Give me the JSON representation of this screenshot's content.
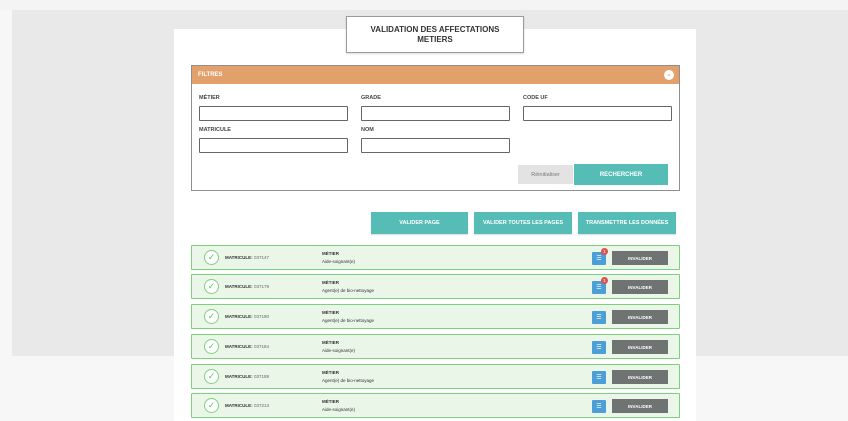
{
  "title": {
    "line1": "VALIDATION DES AFFECTATIONS",
    "line2": "METIERS"
  },
  "filters": {
    "header": "FILTRES",
    "metier_label": "MÉTIER",
    "grade_label": "GRADE",
    "code_uf_label": "CODE UF",
    "matricule_label": "MATRICULE",
    "nom_label": "NOM",
    "metier_value": "",
    "grade_value": "",
    "code_uf_value": "",
    "matricule_value": "",
    "nom_value": "",
    "reset_label": "Réinitialiser",
    "search_label": "RECHERCHER"
  },
  "toolbar": {
    "valider_page": "VALIDER PAGE",
    "valider_toutes": "VALIDER TOUTES LES PAGES",
    "transmettre": "TRANSMETTRE LES DONNÉES"
  },
  "rows": [
    {
      "matricule_label": "MATRICULE:",
      "matricule": "037147",
      "metier_label": "MÉTIER",
      "metier": "Aide-soignant(e)",
      "badge": "1",
      "invalider": "INVALIDER"
    },
    {
      "matricule_label": "MATRICULE:",
      "matricule": "037179",
      "metier_label": "MÉTIER",
      "metier": "Agent(e) de bio-nettoyage",
      "badge": "1",
      "invalider": "INVALIDER"
    },
    {
      "matricule_label": "MATRICULE:",
      "matricule": "037180",
      "metier_label": "MÉTIER",
      "metier": "Agent(e) de bio-nettoyage",
      "badge": "",
      "invalider": "INVALIDER"
    },
    {
      "matricule_label": "MATRICULE:",
      "matricule": "037184",
      "metier_label": "MÉTIER",
      "metier": "Aide-soignant(e)",
      "badge": "",
      "invalider": "INVALIDER"
    },
    {
      "matricule_label": "MATRICULE:",
      "matricule": "037189",
      "metier_label": "MÉTIER",
      "metier": "Agent(e) de bio-nettoyage",
      "badge": "",
      "invalider": "INVALIDER"
    },
    {
      "matricule_label": "MATRICULE:",
      "matricule": "037213",
      "metier_label": "MÉTIER",
      "metier": "Aide-soignant(e)",
      "badge": "",
      "invalider": "INVALIDER"
    }
  ],
  "colors": {
    "accent_teal": "#55bcb6",
    "filters_orange": "#e2a06a",
    "row_green": "#7ed17c",
    "chat_blue": "#4c9fd6",
    "badge_red": "#d9534f"
  }
}
